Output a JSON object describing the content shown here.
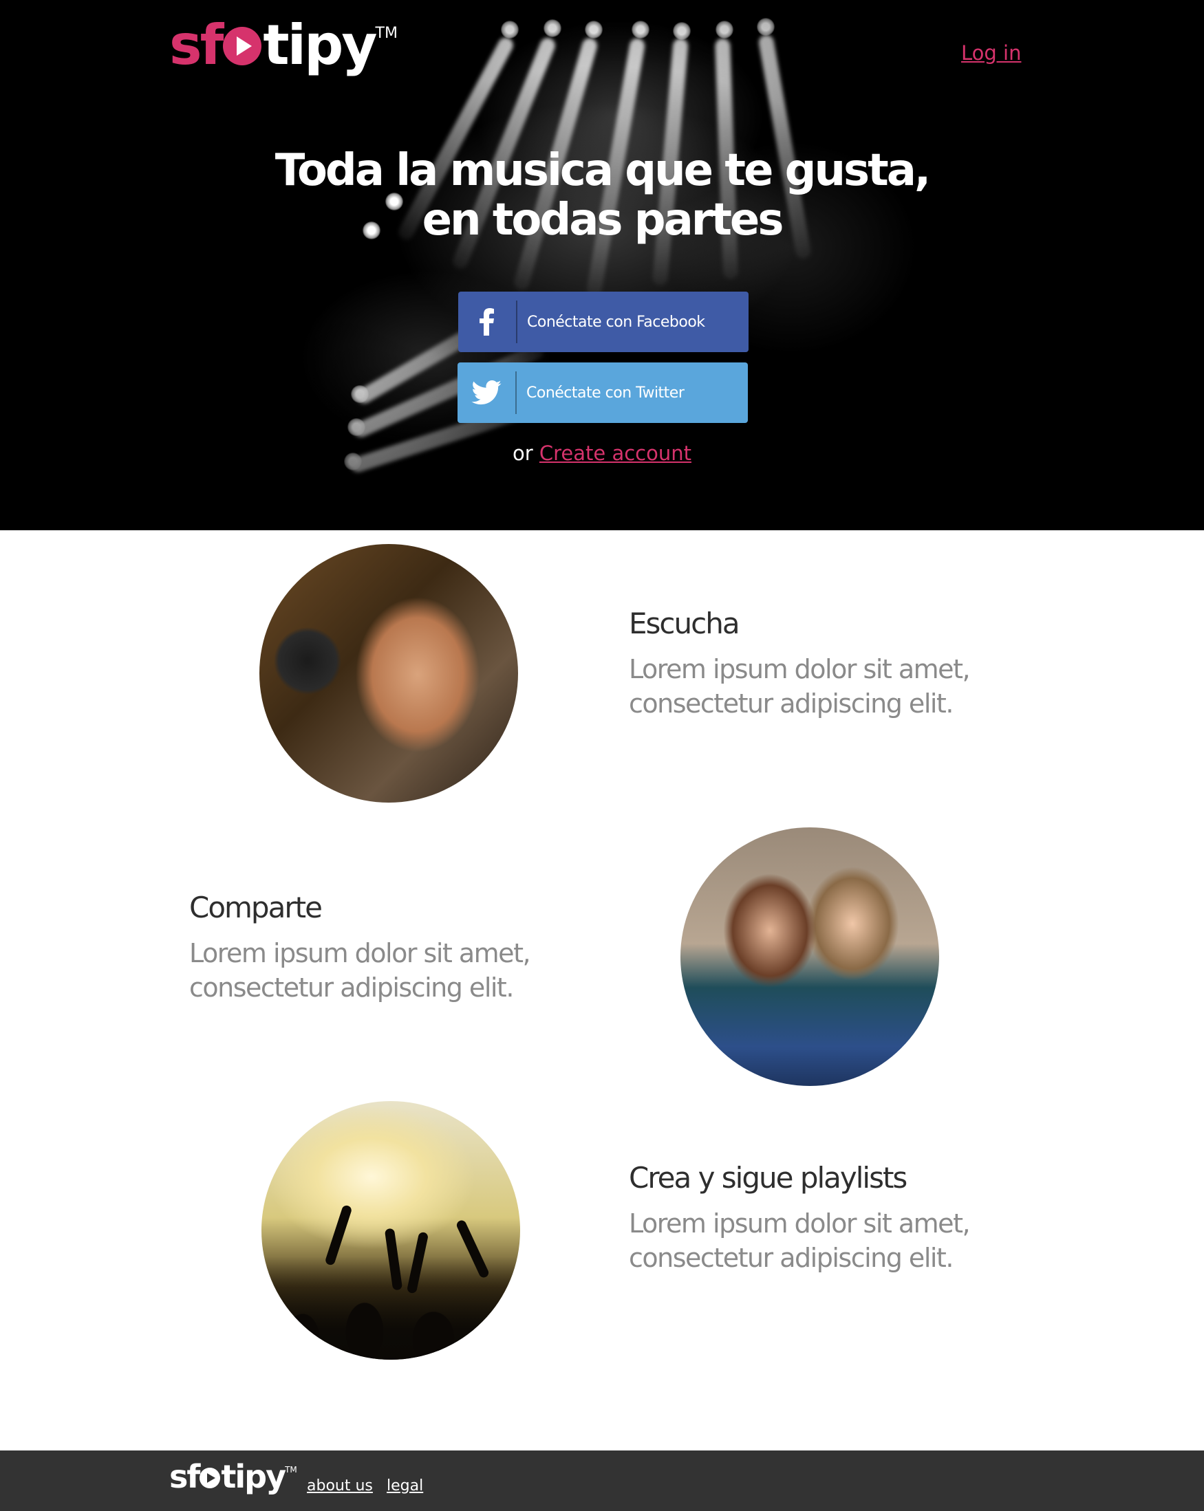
{
  "brand": {
    "name_part1": "sf",
    "name_part2": "ti",
    "name_part3": "py",
    "trademark": "TM",
    "accent_color": "#d6336c"
  },
  "header": {
    "login_label": "Log in"
  },
  "hero": {
    "headline_line1": "Toda la musica que te gusta,",
    "headline_line2": "en todas partes",
    "facebook_button": {
      "label": "Conéctate con Facebook",
      "icon": "facebook-icon",
      "color": "#3f5ba6"
    },
    "twitter_button": {
      "label": "Conéctate con Twitter",
      "icon": "twitter-icon",
      "color": "#5aa6dc"
    },
    "or_text": "or",
    "create_account_label": "Create account"
  },
  "features": [
    {
      "title": "Escucha",
      "text": "Lorem ipsum dolor sit amet, consectetur adipiscing elit."
    },
    {
      "title": "Comparte",
      "text": "Lorem ipsum dolor sit amet, consectetur adipiscing elit."
    },
    {
      "title": "Crea y sigue playlists",
      "text": "Lorem ipsum dolor sit amet, consectetur adipiscing elit."
    }
  ],
  "footer": {
    "logo_part1": "sf",
    "logo_part2": "tipy",
    "trademark": "TM",
    "links": [
      "about us",
      "legal"
    ],
    "background": "#333333"
  }
}
